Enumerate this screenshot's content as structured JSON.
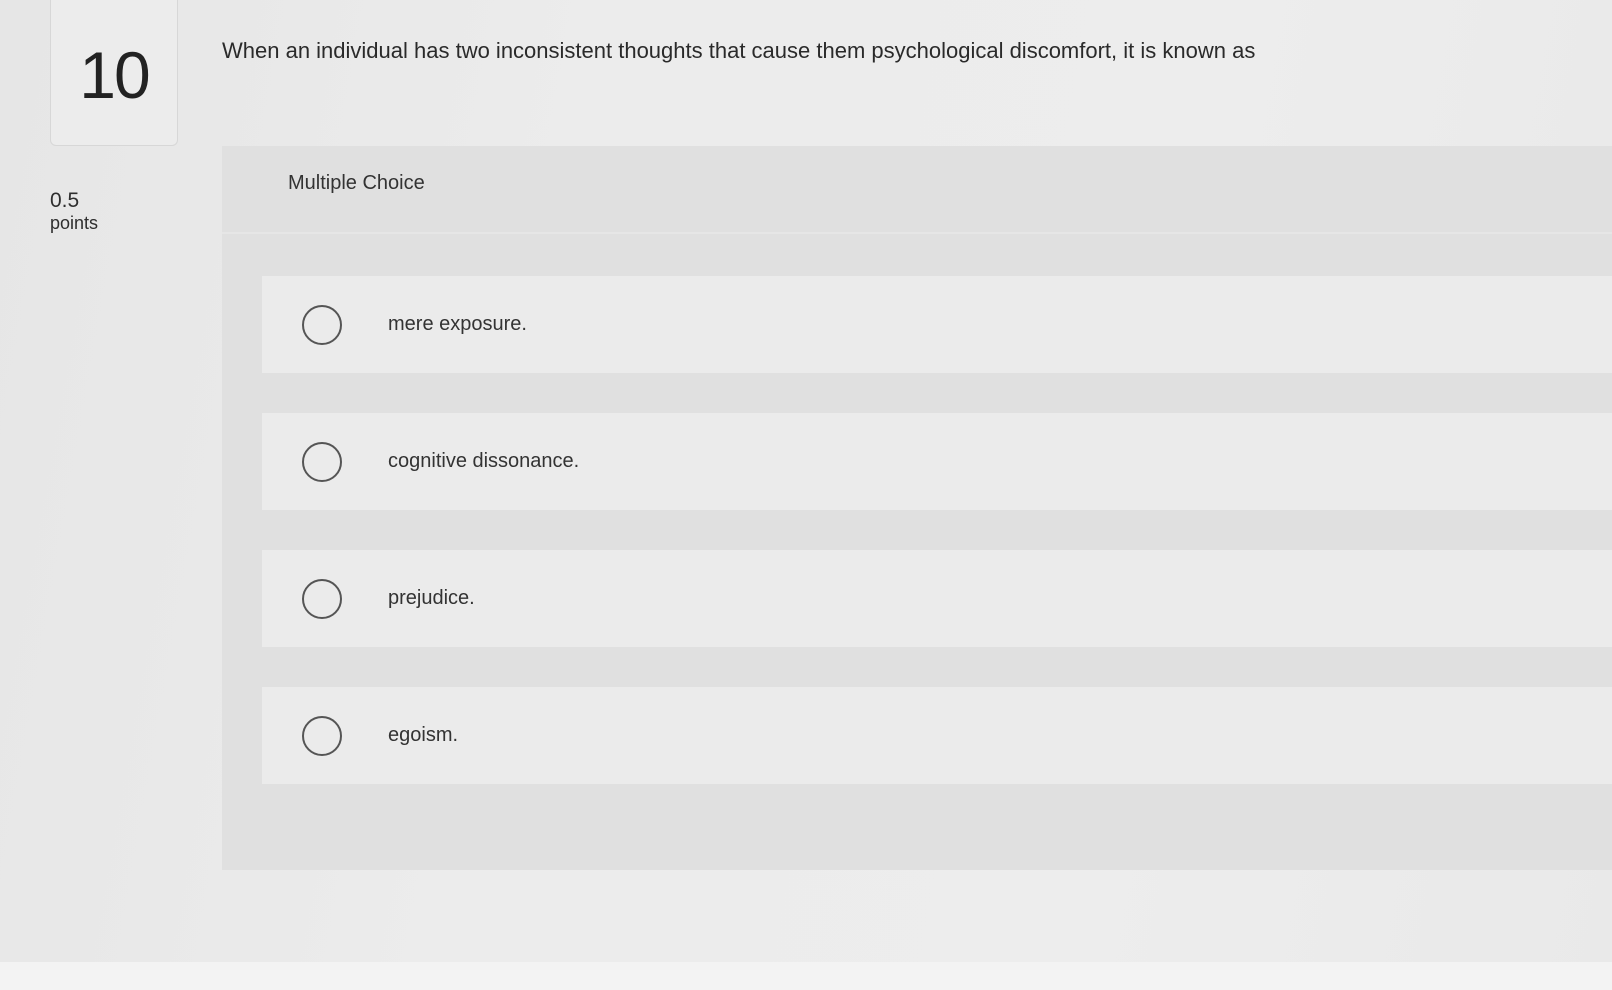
{
  "question": {
    "number": "10",
    "points_value": "0.5",
    "points_label": "points",
    "prompt": "When an individual has two inconsistent thoughts that cause them psychological discomfort, it is known as"
  },
  "answer_area": {
    "type_label": "Multiple Choice",
    "options": [
      {
        "label": "mere exposure."
      },
      {
        "label": "cognitive dissonance."
      },
      {
        "label": "prejudice."
      },
      {
        "label": "egoism."
      }
    ]
  }
}
